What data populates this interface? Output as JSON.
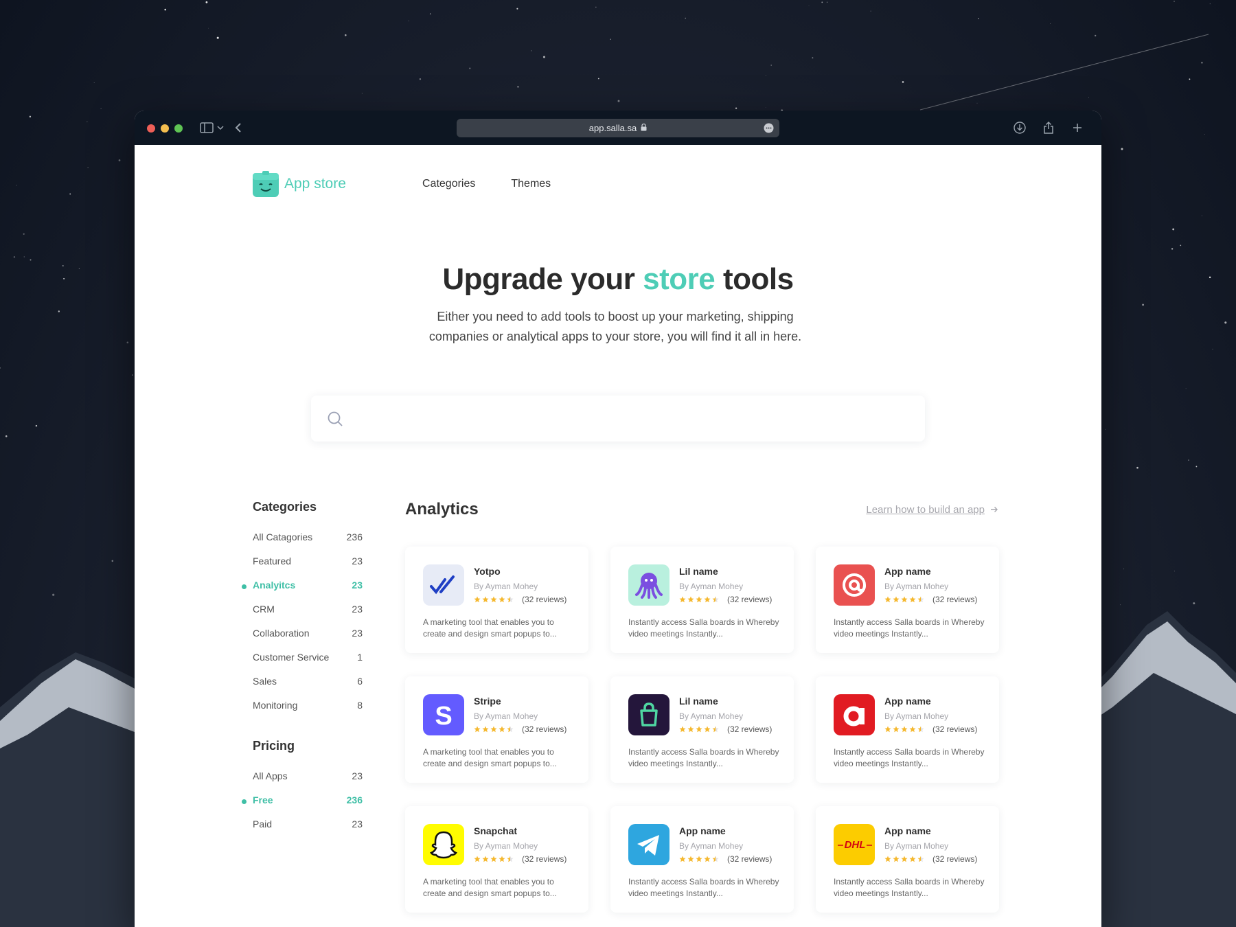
{
  "browser": {
    "url": "app.salla.sa"
  },
  "header": {
    "brand": "App store",
    "nav": [
      "Categories",
      "Themes"
    ]
  },
  "hero": {
    "title_pre": "Upgrade your",
    "title_accent": "store",
    "title_post": "tools",
    "subtitle": "Either you need to add tools to boost up your marketing, shipping companies or analytical apps to your store, you will find it all in here."
  },
  "search": {
    "placeholder": ""
  },
  "sidebar": {
    "categories_heading": "Categories",
    "categories": [
      {
        "label": "All Catagories",
        "count": "236",
        "active": false
      },
      {
        "label": "Featured",
        "count": "23",
        "active": false
      },
      {
        "label": "Analyitcs",
        "count": "23",
        "active": true
      },
      {
        "label": "CRM",
        "count": "23",
        "active": false
      },
      {
        "label": "Collaboration",
        "count": "23",
        "active": false
      },
      {
        "label": "Customer Service",
        "count": "1",
        "active": false
      },
      {
        "label": "Sales",
        "count": "6",
        "active": false
      },
      {
        "label": "Monitoring",
        "count": "8",
        "active": false
      }
    ],
    "pricing_heading": "Pricing",
    "pricing": [
      {
        "label": "All Apps",
        "count": "23",
        "active": false
      },
      {
        "label": "Free",
        "count": "236",
        "active": true
      },
      {
        "label": "Paid",
        "count": "23",
        "active": false
      }
    ]
  },
  "main": {
    "title": "Analytics",
    "learn_link": "Learn how to build an app",
    "apps": [
      {
        "name": "Yotpo",
        "by": "By Ayman Mohey",
        "rating": 4.5,
        "reviews": "(32 reviews)",
        "desc": "A marketing tool that enables you to create and design smart popups to...",
        "icon": "yotpo-icon"
      },
      {
        "name": "Lil name",
        "by": "By Ayman Mohey",
        "rating": 4.5,
        "reviews": "(32 reviews)",
        "desc": "Instantly access Salla boards in Whereby video meetings Instantly...",
        "icon": "octopus-icon"
      },
      {
        "name": "App name",
        "by": "By Ayman Mohey",
        "rating": 4.5,
        "reviews": "(32 reviews)",
        "desc": "Instantly access Salla boards in Whereby video meetings Instantly...",
        "icon": "at-sign-icon"
      },
      {
        "name": "Stripe",
        "by": "By Ayman Mohey",
        "rating": 4.5,
        "reviews": "(32 reviews)",
        "desc": "A marketing tool that enables you to create and design smart popups to...",
        "icon": "stripe-icon"
      },
      {
        "name": "Lil name",
        "by": "By Ayman Mohey",
        "rating": 4.5,
        "reviews": "(32 reviews)",
        "desc": "Instantly access Salla boards in Whereby video meetings Instantly...",
        "icon": "shopping-bag-icon"
      },
      {
        "name": "App name",
        "by": "By Ayman Mohey",
        "rating": 4.5,
        "reviews": "(32 reviews)",
        "desc": "Instantly access Salla boards in Whereby video meetings Instantly...",
        "icon": "letter-a-icon"
      },
      {
        "name": "Snapchat",
        "by": "By Ayman Mohey",
        "rating": 4.5,
        "reviews": "(32 reviews)",
        "desc": "A marketing tool that enables you to create and design smart popups to...",
        "icon": "snapchat-icon"
      },
      {
        "name": "App name",
        "by": "By Ayman Mohey",
        "rating": 4.5,
        "reviews": "(32 reviews)",
        "desc": "Instantly access Salla boards in Whereby video meetings Instantly...",
        "icon": "telegram-icon"
      },
      {
        "name": "App name",
        "by": "By Ayman Mohey",
        "rating": 4.5,
        "reviews": "(32 reviews)",
        "desc": "Instantly access Salla boards in Whereby video meetings Instantly...",
        "icon": "dhl-icon"
      }
    ]
  },
  "colors": {
    "accent": "#4ecdb6",
    "star": "#f5b82e",
    "titlebar": "#0d1622"
  }
}
